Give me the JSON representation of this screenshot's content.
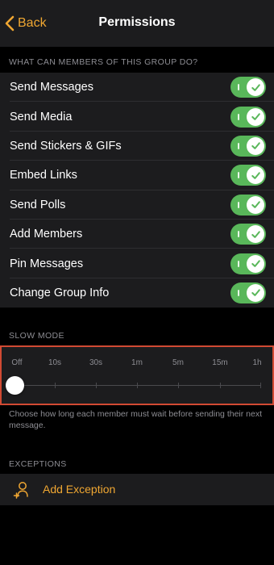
{
  "nav": {
    "back_label": "Back",
    "title": "Permissions"
  },
  "permissions": {
    "header": "WHAT CAN MEMBERS OF THIS GROUP DO?",
    "items": [
      {
        "label": "Send Messages",
        "enabled": true
      },
      {
        "label": "Send Media",
        "enabled": true
      },
      {
        "label": "Send Stickers & GIFs",
        "enabled": true
      },
      {
        "label": "Embed Links",
        "enabled": true
      },
      {
        "label": "Send Polls",
        "enabled": true
      },
      {
        "label": "Add Members",
        "enabled": true
      },
      {
        "label": "Pin Messages",
        "enabled": true
      },
      {
        "label": "Change Group Info",
        "enabled": true
      }
    ]
  },
  "slow_mode": {
    "header": "SLOW MODE",
    "options": [
      "Off",
      "10s",
      "30s",
      "1m",
      "5m",
      "15m",
      "1h"
    ],
    "selected": "Off",
    "hint": "Choose how long each member must wait before sending their next message."
  },
  "exceptions": {
    "header": "EXCEPTIONS",
    "add_label": "Add Exception",
    "add_icon": "add-person-icon"
  },
  "colors": {
    "accent": "#f0a732",
    "toggle_on": "#59b75a",
    "highlight_border": "#d14a33",
    "background": "#000000",
    "cell": "#1c1c1e"
  }
}
